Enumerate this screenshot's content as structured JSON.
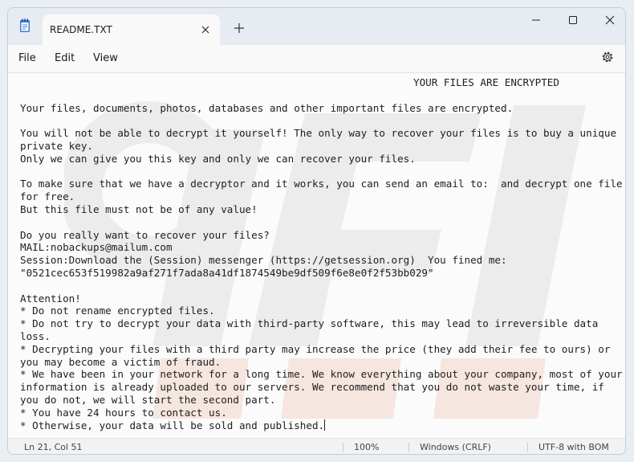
{
  "tab": {
    "title": "README.TXT"
  },
  "menu": {
    "file": "File",
    "edit": "Edit",
    "view": "View"
  },
  "document": {
    "heading": "YOUR FILES ARE ENCRYPTED",
    "body": "Your files, documents, photos, databases and other important files are encrypted.\n\nYou will not be able to decrypt it yourself! The only way to recover your files is to buy a unique private key.\nOnly we can give you this key and only we can recover your files.\n\nTo make sure that we have a decryptor and it works, you can send an email to:  and decrypt one file for free.\nBut this file must not be of any value!\n\nDo you really want to recover your files?\nMAIL:nobackups@mailum.com\nSession:Download the (Session) messenger (https://getsession.org)  You fined me:\n\"0521cec653f519982a9af271f7ada8a41df1874549be9df509f6e8e0f2f53bb029\"\n\nAttention!\n* Do not rename encrypted files.\n* Do not try to decrypt your data with third-party software, this may lead to irreversible data loss.\n* Decrypting your files with a third party may increase the price (they add their fee to ours) or you may become a victim of fraud.\n* We have been in your network for a long time. We know everything about your company, most of your information is already uploaded to our servers. We recommend that you do not waste your time, if you do not, we will start the second part.\n* You have 24 hours to contact us.\n* Otherwise, your data will be sold and published."
  },
  "status": {
    "position": "Ln 21, Col 51",
    "zoom": "100%",
    "line_ending": "Windows (CRLF)",
    "encoding": "UTF-8 with BOM"
  },
  "icons": [
    "notepad-app-icon",
    "close-tab-icon",
    "plus-icon",
    "minimize-icon",
    "maximize-icon",
    "close-icon",
    "gear-icon"
  ],
  "colors": {
    "titlebar": "#e6ecf1",
    "editor_bg": "#fbfbfb",
    "text": "#1e1e1e",
    "watermark": "#ebebeb"
  }
}
